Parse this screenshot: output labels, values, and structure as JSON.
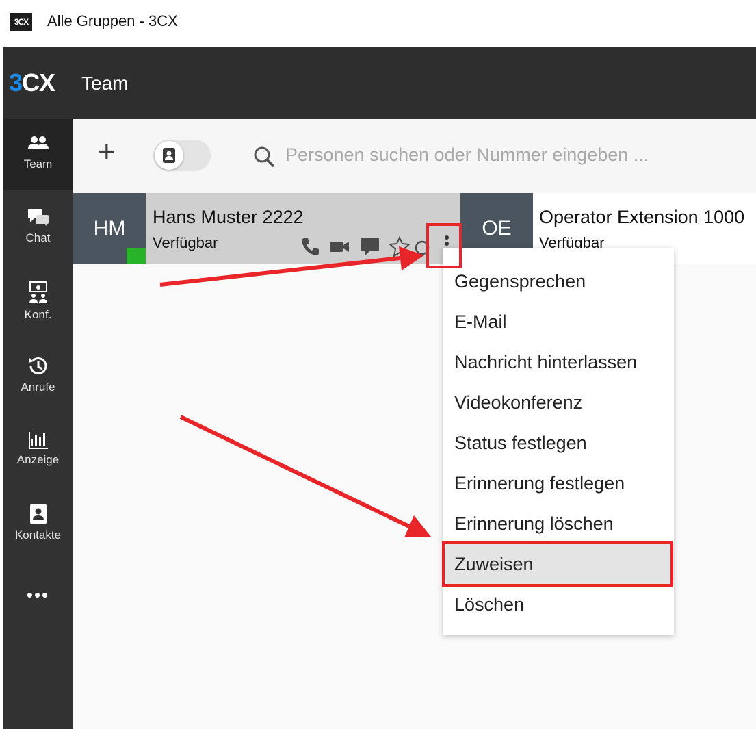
{
  "window": {
    "title": "Alle Gruppen - 3CX",
    "icon_text": "3CX"
  },
  "header": {
    "logo_prefix": "3",
    "logo_suffix": "CX",
    "title": "Team"
  },
  "nav": {
    "items": [
      {
        "label": "Team",
        "icon": "team-icon"
      },
      {
        "label": "Chat",
        "icon": "chat-icon"
      },
      {
        "label": "Konf.",
        "icon": "conference-icon"
      },
      {
        "label": "Anrufe",
        "icon": "history-icon"
      },
      {
        "label": "Anzeige",
        "icon": "chart-icon"
      },
      {
        "label": "Kontakte",
        "icon": "contacts-icon"
      }
    ],
    "more": "•••"
  },
  "toolbar": {
    "add_label": "+",
    "search_placeholder": "Personen suchen oder Nummer eingeben ..."
  },
  "contacts": [
    {
      "initials": "HM",
      "name": "Hans Muster 2222",
      "status": "Verfügbar",
      "presence_color": "#29b329"
    },
    {
      "initials": "OE",
      "name": "Operator Extension 1000",
      "status": "Verfügbar",
      "presence_color": "#29b329"
    }
  ],
  "context_menu": {
    "items": [
      "Gegensprechen",
      "E-Mail",
      "Nachricht hinterlassen",
      "Videokonferenz",
      "Status festlegen",
      "Erinnerung festlegen",
      "Erinnerung löschen",
      "Zuweisen",
      "Löschen"
    ],
    "highlighted": "Zuweisen"
  },
  "colors": {
    "accent": "#1e88e5",
    "annotation": "#e8262a",
    "presence": "#29b329"
  }
}
